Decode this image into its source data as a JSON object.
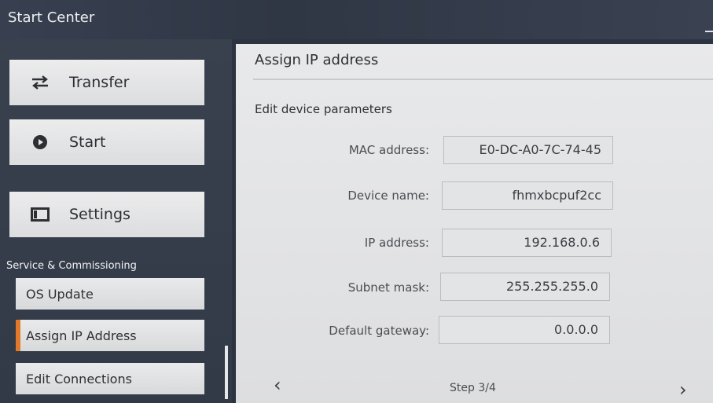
{
  "app": {
    "title": "Start Center"
  },
  "sidebar": {
    "buttons": [
      {
        "label": "Transfer",
        "icon": "transfer-arrows-icon"
      },
      {
        "label": "Start",
        "icon": "play-circle-icon"
      },
      {
        "label": "Settings",
        "icon": "settings-window-icon"
      }
    ],
    "section_label": "Service & Commissioning",
    "sub_items": [
      {
        "label": "OS Update",
        "active": false
      },
      {
        "label": "Assign IP Address",
        "active": true
      },
      {
        "label": "Edit Connections",
        "active": false
      }
    ]
  },
  "content": {
    "title": "Assign IP address",
    "section_title": "Edit device parameters",
    "fields": [
      {
        "label": "MAC address:",
        "value": "E0-DC-A0-7C-74-45"
      },
      {
        "label": "Device name:",
        "value": "fhmxbcpuf2cc"
      },
      {
        "label": "IP address:",
        "value": "192.168.0.6"
      },
      {
        "label": "Subnet mask:",
        "value": "255.255.255.0"
      },
      {
        "label": "Default gateway:",
        "value": "0.0.0.0"
      }
    ],
    "nav": {
      "prev": "‹",
      "next": "›",
      "step": "Step 3/4"
    }
  },
  "colors": {
    "accent": "#e07a2a",
    "sidebar_bg": "#323a47",
    "panel_bg": "#e6e7e9"
  }
}
